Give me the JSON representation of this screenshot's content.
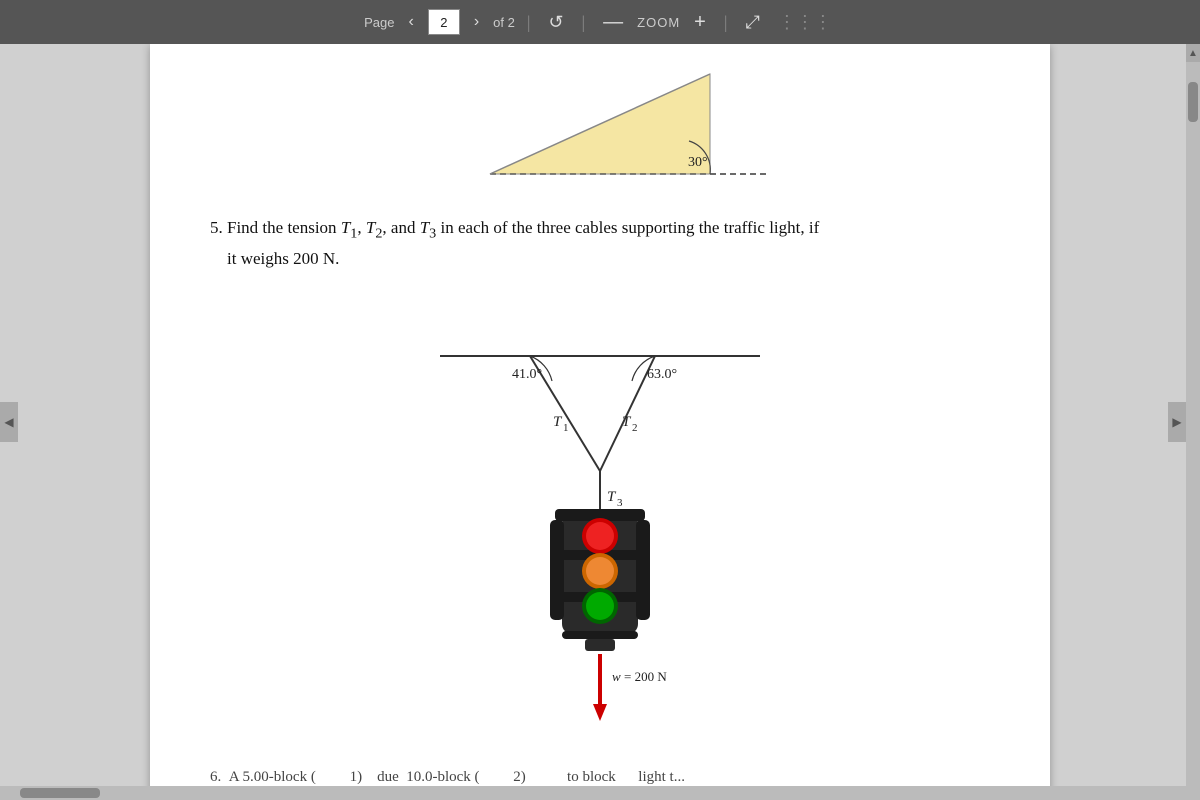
{
  "toolbar": {
    "page_label": "Page",
    "page_current": "2",
    "page_total": "of 2",
    "zoom_label": "ZOOM",
    "prev_icon": "‹",
    "next_icon": "›",
    "minus_icon": "—",
    "plus_icon": "+",
    "fit_icon": "⤢",
    "reset_icon": "↺"
  },
  "problem5": {
    "number": "5.",
    "text": "Find the tension T₁, T₂, and T₃ in each of the three cables supporting the traffic light, if it weighs 200 N."
  },
  "diagram": {
    "angle1": "41.0°",
    "angle2": "63.0°",
    "label_T1": "T₁",
    "label_T2": "T₂",
    "label_T3": "T₃",
    "weight_label": "w = 200 N"
  },
  "top_diagram": {
    "angle_label": "30°"
  },
  "bottom_partial": "6.  A 5.00-block (         1)    due  10.0-block (          2)           to block      light t..."
}
